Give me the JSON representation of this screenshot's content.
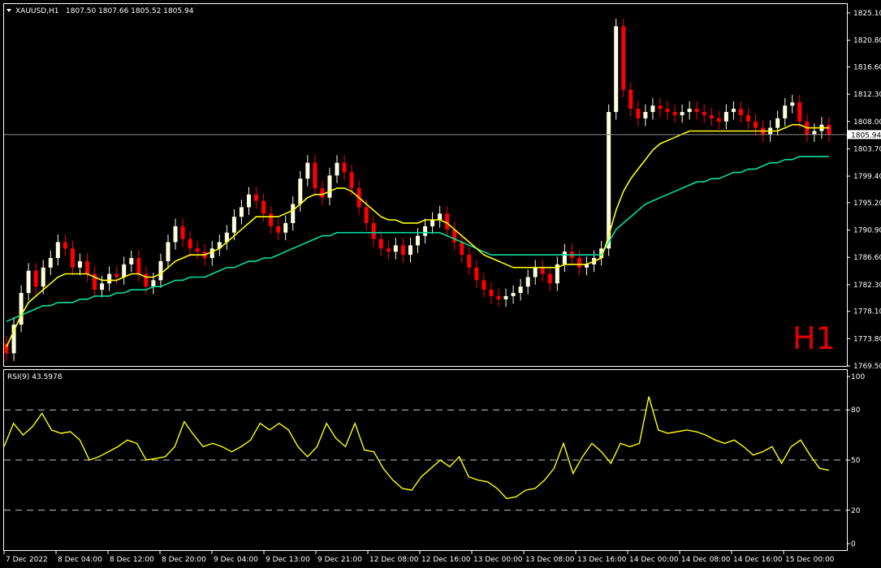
{
  "header": {
    "symbol": "XAUUSD,H1",
    "ohlc": "1807.50 1807.66 1805.52 1805.94"
  },
  "watermark": "H1",
  "colors": {
    "background": "#000000",
    "axis": "#ffffff",
    "bull_candle": "#ffffe0",
    "bear_candle": "#ff0000",
    "ma_fast": "#ffff00",
    "ma_slow": "#00e0a0",
    "rsi_line": "#ffff00",
    "watermark": "#e00000"
  },
  "chart_data": [
    {
      "type": "candlestick",
      "title": "XAUUSD,H1",
      "ylim": [
        1769.5,
        1826.5
      ],
      "y_ticks": [
        "1825.10",
        "1820.80",
        "1816.60",
        "1812.30",
        "1808.00",
        "1803.70",
        "1799.40",
        "1795.20",
        "1790.90",
        "1786.60",
        "1782.30",
        "1778.10",
        "1773.80",
        "1769.50"
      ],
      "current_price_label": "1805.94",
      "current_price": 1805.94,
      "x_labels": [
        "7 Dec 2022",
        "8 Dec 04:00",
        "8 Dec 12:00",
        "8 Dec 20:00",
        "9 Dec 04:00",
        "9 Dec 13:00",
        "9 Dec 21:00",
        "12 Dec 08:00",
        "12 Dec 16:00",
        "13 Dec 00:00",
        "13 Dec 08:00",
        "13 Dec 16:00",
        "14 Dec 00:00",
        "14 Dec 08:00",
        "14 Dec 16:00",
        "15 Dec 00:00"
      ],
      "series_close": [
        1771.5,
        1776.0,
        1781.0,
        1784.5,
        1782.0,
        1785.0,
        1786.5,
        1789.0,
        1788.0,
        1785.0,
        1786.0,
        1784.0,
        1781.5,
        1782.5,
        1784.0,
        1783.5,
        1785.5,
        1786.5,
        1784.0,
        1782.0,
        1783.0,
        1786.0,
        1789.0,
        1791.5,
        1789.5,
        1788.0,
        1787.5,
        1786.5,
        1788.0,
        1789.0,
        1790.5,
        1793.0,
        1794.5,
        1796.5,
        1795.5,
        1793.5,
        1791.5,
        1790.5,
        1792.0,
        1795.0,
        1799.0,
        1801.5,
        1797.5,
        1796.0,
        1799.5,
        1801.5,
        1800.0,
        1797.5,
        1794.5,
        1792.0,
        1789.5,
        1788.0,
        1787.5,
        1788.5,
        1787.0,
        1788.5,
        1790.0,
        1791.5,
        1792.5,
        1793.5,
        1791.0,
        1789.0,
        1787.0,
        1785.0,
        1783.0,
        1781.5,
        1780.5,
        1780.0,
        1780.5,
        1781.0,
        1782.0,
        1783.5,
        1785.0,
        1784.0,
        1782.5,
        1785.5,
        1787.5,
        1786.5,
        1785.0,
        1785.5,
        1786.5,
        1788.0,
        1809.5,
        1823.0,
        1813.0,
        1810.0,
        1808.5,
        1809.5,
        1810.5,
        1810.0,
        1809.5,
        1809.0,
        1809.5,
        1810.0,
        1809.5,
        1809.0,
        1808.5,
        1808.0,
        1809.5,
        1810.0,
        1809.0,
        1808.0,
        1807.0,
        1806.0,
        1807.0,
        1808.5,
        1810.5,
        1811.0,
        1808.0,
        1806.0,
        1806.5,
        1807.5,
        1806.0
      ],
      "ma_fast": [
        1772.5,
        1775.0,
        1777.5,
        1779.5,
        1780.5,
        1781.5,
        1782.5,
        1783.5,
        1784.0,
        1784.0,
        1784.0,
        1784.0,
        1783.5,
        1783.0,
        1783.0,
        1783.0,
        1783.5,
        1784.0,
        1784.0,
        1783.5,
        1783.5,
        1784.0,
        1785.0,
        1786.0,
        1786.5,
        1787.0,
        1787.0,
        1787.0,
        1787.5,
        1788.0,
        1789.0,
        1790.0,
        1791.0,
        1792.0,
        1793.0,
        1793.0,
        1793.0,
        1793.0,
        1793.5,
        1794.0,
        1795.0,
        1796.0,
        1796.5,
        1796.5,
        1797.0,
        1797.5,
        1797.5,
        1797.0,
        1796.0,
        1795.0,
        1794.0,
        1793.0,
        1792.5,
        1792.5,
        1792.0,
        1792.0,
        1792.0,
        1792.5,
        1792.5,
        1792.5,
        1792.0,
        1791.0,
        1790.0,
        1789.0,
        1788.0,
        1787.0,
        1786.5,
        1786.0,
        1785.5,
        1785.0,
        1785.0,
        1785.0,
        1785.0,
        1785.0,
        1785.0,
        1785.0,
        1785.5,
        1785.5,
        1785.5,
        1785.5,
        1786.0,
        1786.5,
        1790.0,
        1794.0,
        1797.0,
        1799.0,
        1800.5,
        1802.0,
        1803.5,
        1804.5,
        1805.0,
        1805.5,
        1806.0,
        1806.5,
        1806.5,
        1806.5,
        1806.5,
        1806.5,
        1806.5,
        1806.5,
        1806.5,
        1806.5,
        1806.5,
        1806.5,
        1806.5,
        1806.5,
        1807.0,
        1807.5,
        1807.5,
        1807.0,
        1807.0,
        1807.0,
        1807.0
      ],
      "ma_slow": [
        1776.5,
        1777.0,
        1777.5,
        1778.0,
        1778.5,
        1779.0,
        1779.0,
        1779.5,
        1779.5,
        1779.5,
        1780.0,
        1780.0,
        1780.5,
        1780.5,
        1780.5,
        1781.0,
        1781.0,
        1781.5,
        1781.5,
        1781.5,
        1782.0,
        1782.0,
        1782.5,
        1783.0,
        1783.0,
        1783.5,
        1783.5,
        1783.5,
        1784.0,
        1784.5,
        1785.0,
        1785.0,
        1785.5,
        1786.0,
        1786.0,
        1786.5,
        1786.5,
        1787.0,
        1787.5,
        1788.0,
        1788.5,
        1789.0,
        1789.5,
        1790.0,
        1790.0,
        1790.5,
        1790.5,
        1790.5,
        1790.5,
        1790.5,
        1790.5,
        1790.5,
        1790.5,
        1790.5,
        1790.5,
        1790.5,
        1790.5,
        1790.5,
        1790.5,
        1790.5,
        1790.0,
        1789.5,
        1789.0,
        1788.5,
        1788.0,
        1787.5,
        1787.0,
        1787.0,
        1787.0,
        1787.0,
        1787.0,
        1787.0,
        1787.0,
        1787.0,
        1787.0,
        1787.0,
        1787.0,
        1787.0,
        1787.0,
        1787.0,
        1787.0,
        1787.0,
        1789.0,
        1791.0,
        1792.0,
        1793.0,
        1794.0,
        1795.0,
        1795.5,
        1796.0,
        1796.5,
        1797.0,
        1797.5,
        1798.0,
        1798.5,
        1798.5,
        1799.0,
        1799.0,
        1799.5,
        1800.0,
        1800.0,
        1800.5,
        1800.5,
        1801.0,
        1801.5,
        1801.5,
        1802.0,
        1802.0,
        1802.5,
        1802.5,
        1802.5,
        1802.5,
        1802.5
      ]
    },
    {
      "type": "line",
      "title": "RSI(9) 43.5978",
      "ylim": [
        0,
        100
      ],
      "y_ticks": [
        "100",
        "80",
        "50",
        "20",
        "0"
      ],
      "levels": [
        80,
        50,
        20
      ],
      "values": [
        58,
        72,
        65,
        70,
        78,
        68,
        66,
        67,
        62,
        50,
        52,
        55,
        58,
        62,
        60,
        50,
        51,
        52,
        58,
        73,
        65,
        58,
        60,
        58,
        55,
        58,
        62,
        72,
        68,
        72,
        68,
        58,
        52,
        58,
        72,
        63,
        58,
        72,
        56,
        55,
        45,
        38,
        33,
        32,
        40,
        45,
        50,
        46,
        52,
        40,
        38,
        37,
        33,
        27,
        28,
        32,
        33,
        38,
        45,
        60,
        42,
        52,
        60,
        55,
        48,
        60,
        58,
        60,
        88,
        68,
        66,
        67,
        68,
        67,
        65,
        62,
        60,
        62,
        58,
        53,
        55,
        58,
        48,
        58,
        62,
        53,
        45,
        44
      ]
    }
  ]
}
